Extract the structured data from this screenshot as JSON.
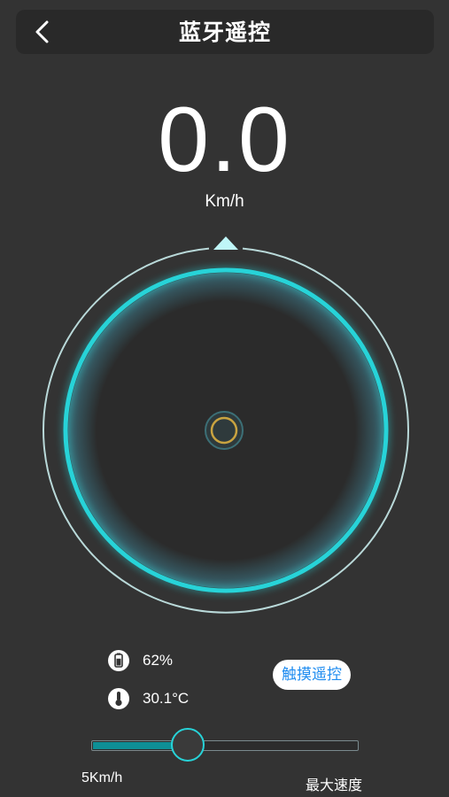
{
  "header": {
    "back_icon": "chevron-left-icon",
    "title": "蓝牙遥控"
  },
  "speed": {
    "value": "0.0",
    "unit": "Km/h"
  },
  "dial": {
    "pointer_icon": "triangle-up-icon",
    "colors": {
      "outer_ring": "#b9d9d9",
      "inner_ring": "#27d3d8",
      "center_knob": "#c9a340"
    }
  },
  "status": {
    "battery": {
      "icon": "battery-icon",
      "value": "62%",
      "level": 0.62
    },
    "temperature": {
      "icon": "thermometer-icon",
      "value": "30.1°C"
    }
  },
  "touch_remote": {
    "label": "触摸遥控"
  },
  "speed_slider": {
    "value_fraction": 0.37,
    "min_label": "5Km/h",
    "max_label": "最大速度",
    "colors": {
      "fill": "#0e8f96",
      "thumb_border": "#27d3d8"
    }
  }
}
